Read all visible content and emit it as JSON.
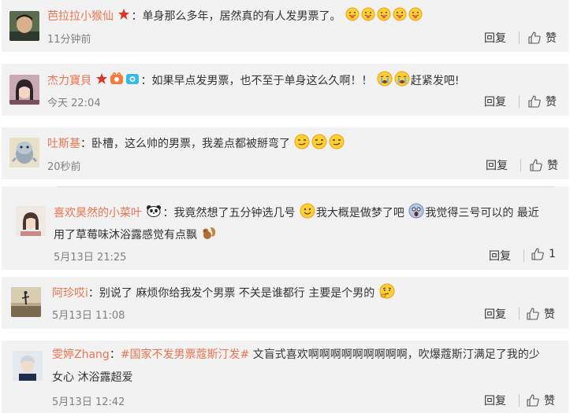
{
  "actions": {
    "reply": "回复",
    "like": "赞"
  },
  "comments": [
    {
      "username": "芭拉拉小猴仙",
      "separator": "：",
      "text": "单身那么多年，居然真的有人发男票了。",
      "time": "11分钟前",
      "like_count": ""
    },
    {
      "username": "杰力寶貝",
      "separator": "：",
      "text_part1": "如果早点发男票，也不至于单身这么久啊！！",
      "text_part2": "赶紧发吧!",
      "time": "今天 22:04",
      "like_count": ""
    },
    {
      "username": "吐斯基",
      "separator": "：",
      "text": "卧槽，这么帅的男票，我差点都被掰弯了",
      "time": "20秒前",
      "like_count": ""
    },
    {
      "username": "喜欢昊然的小菜叶",
      "separator": "：",
      "text_part1": "我竟然想了五分钟选几号",
      "text_part2": "我大概是做梦了吧",
      "text_part3": "我觉得三号可以的 最近",
      "text_line2": "用了草莓味沐浴露感觉有点飘",
      "time": "5月13日 21:25",
      "like_count": "1"
    },
    {
      "username": "阿珍哎i",
      "separator": "：",
      "text": "别说了 麻烦你给我发个男票 不关是谁都行 主要是个男的",
      "time": "5月13日 11:08",
      "like_count": ""
    },
    {
      "username": "雯婷Zhang",
      "separator": "：",
      "topic": "#国家不发男票蔻斯汀发#",
      "text_part1": " 文盲式喜欢啊啊啊啊啊啊啊啊啊，吹爆蔻斯汀满足了我的少",
      "text_line2": "女心 沐浴露超爱",
      "time": "5月13日 12:42",
      "like_count": ""
    }
  ]
}
